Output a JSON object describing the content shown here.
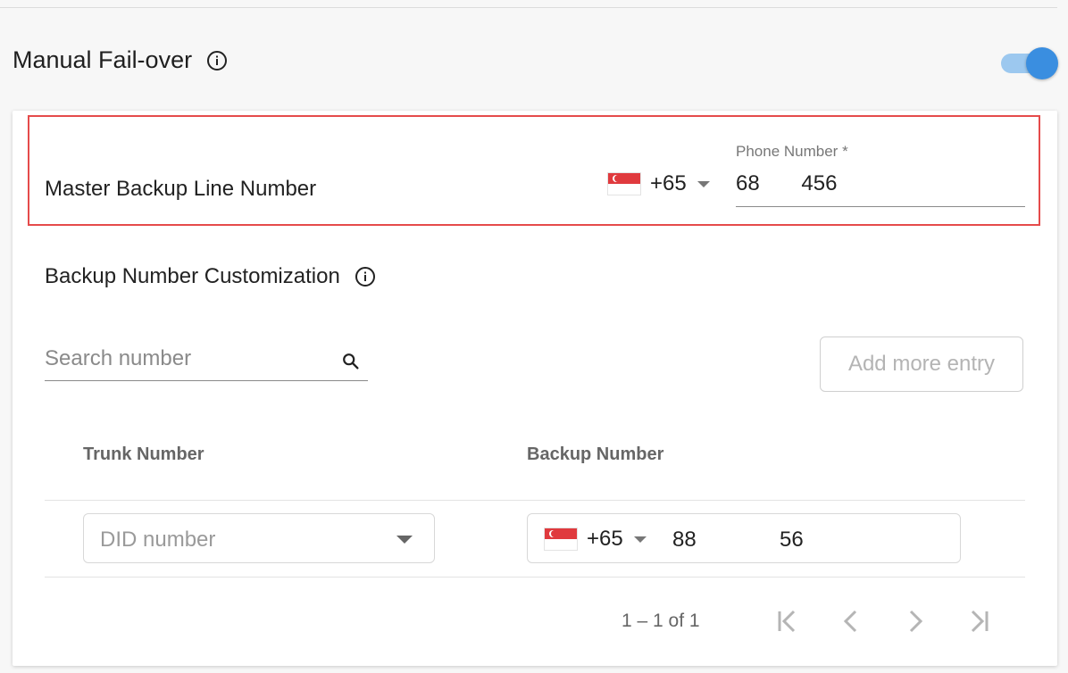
{
  "header": {
    "title": "Manual Fail-over",
    "toggle_on": true,
    "accent_color": "#3a8ee0"
  },
  "master": {
    "label": "Master Backup Line Number",
    "country_code": "+65",
    "country_flag": "singapore-flag-icon",
    "phone_label": "Phone Number *",
    "phone_value": "68       456"
  },
  "customization": {
    "title": "Backup Number Customization",
    "search_placeholder": "Search number",
    "add_button": "Add more entry"
  },
  "table": {
    "columns": [
      "Trunk Number",
      "Backup Number"
    ],
    "rows": [
      {
        "trunk_placeholder": "DID number",
        "backup_country_code": "+65",
        "backup_value": "88              56"
      }
    ]
  },
  "pagination": {
    "range": "1 – 1 of 1"
  }
}
